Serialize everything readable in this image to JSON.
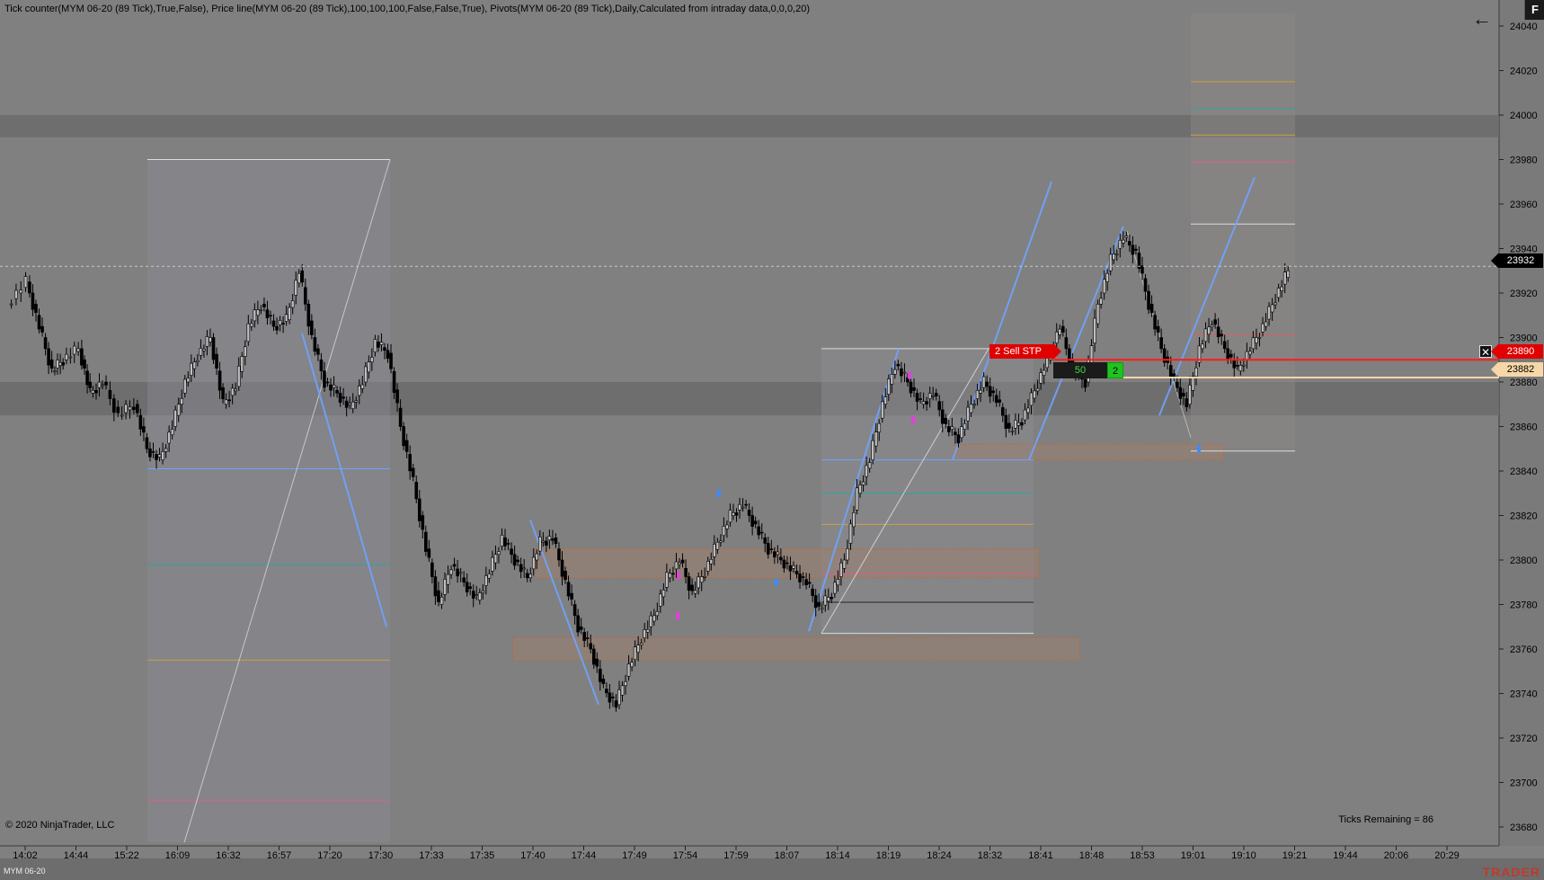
{
  "header": {
    "indicators": "Tick counter(MYM 06-20 (89 Tick),True,False), Price line(MYM 06-20 (89 Tick),100,100,100,False,False,True), Pivots(MYM 06-20 (89 Tick),Daily,Calculated from intraday data,0,0,0,20)"
  },
  "footer": {
    "copyright": "© 2020 NinjaTrader, LLC",
    "ticks_remaining": "Ticks Remaining = 86",
    "instrument": "MYM 06-20",
    "brand": "TRADER"
  },
  "toolbar": {
    "corner_label": "F",
    "back_icon": "arrow-left-icon"
  },
  "order": {
    "sell_label": "2  Sell STP",
    "position_pnl": "50",
    "position_qty": "2",
    "close_icon": "close-x-icon"
  },
  "price_tags": {
    "last": "23932",
    "sell_stop": "23890",
    "avg_entry": "23882"
  },
  "colors": {
    "background": "#808080",
    "candle": "#000000",
    "swing_line": "#6fa3ff",
    "sell_line": "#ff1a1a",
    "entry_line": "#f5d7a8",
    "zone_border": "#c06a33"
  },
  "chart_data": {
    "type": "candlestick",
    "y_ticks": [
      24040,
      24020,
      24000,
      23980,
      23960,
      23940,
      23920,
      23900,
      23880,
      23860,
      23840,
      23820,
      23800,
      23780,
      23760,
      23740,
      23720,
      23700,
      23680
    ],
    "ylim": [
      23673,
      24046
    ],
    "x_ticks": [
      "14:02",
      "14:44",
      "15:22",
      "16:09",
      "16:32",
      "16:57",
      "17:20",
      "17:30",
      "17:33",
      "17:35",
      "17:40",
      "17:44",
      "17:49",
      "17:54",
      "17:59",
      "18:07",
      "18:14",
      "18:19",
      "18:24",
      "18:32",
      "18:41",
      "18:48",
      "18:53",
      "19:01",
      "19:10",
      "19:21",
      "19:44",
      "20:06",
      "20:29"
    ],
    "last_price": 23932,
    "sell_stop_price": 23890,
    "avg_entry_price": 23882,
    "pivot_bands": [
      [
        23990,
        24000
      ],
      [
        23865,
        23880
      ]
    ],
    "close_path": [
      [
        0,
        23915
      ],
      [
        12,
        23925
      ],
      [
        20,
        23905
      ],
      [
        28,
        23885
      ],
      [
        35,
        23890
      ],
      [
        45,
        23895
      ],
      [
        52,
        23875
      ],
      [
        60,
        23880
      ],
      [
        70,
        23865
      ],
      [
        80,
        23870
      ],
      [
        88,
        23850
      ],
      [
        96,
        23845
      ],
      [
        104,
        23860
      ],
      [
        112,
        23880
      ],
      [
        120,
        23892
      ],
      [
        128,
        23900
      ],
      [
        136,
        23870
      ],
      [
        144,
        23878
      ],
      [
        152,
        23905
      ],
      [
        160,
        23915
      ],
      [
        168,
        23905
      ],
      [
        176,
        23908
      ],
      [
        184,
        23930
      ],
      [
        192,
        23900
      ],
      [
        200,
        23880
      ],
      [
        208,
        23875
      ],
      [
        216,
        23868
      ],
      [
        224,
        23880
      ],
      [
        232,
        23898
      ],
      [
        240,
        23893
      ],
      [
        248,
        23860
      ],
      [
        256,
        23835
      ],
      [
        264,
        23805
      ],
      [
        272,
        23780
      ],
      [
        280,
        23798
      ],
      [
        288,
        23790
      ],
      [
        296,
        23782
      ],
      [
        304,
        23795
      ],
      [
        312,
        23810
      ],
      [
        320,
        23800
      ],
      [
        328,
        23792
      ],
      [
        336,
        23808
      ],
      [
        344,
        23810
      ],
      [
        352,
        23790
      ],
      [
        360,
        23770
      ],
      [
        368,
        23760
      ],
      [
        376,
        23742
      ],
      [
        384,
        23735
      ],
      [
        392,
        23752
      ],
      [
        400,
        23765
      ],
      [
        408,
        23775
      ],
      [
        416,
        23792
      ],
      [
        424,
        23800
      ],
      [
        432,
        23785
      ],
      [
        440,
        23795
      ],
      [
        448,
        23808
      ],
      [
        456,
        23820
      ],
      [
        464,
        23825
      ],
      [
        472,
        23815
      ],
      [
        480,
        23805
      ],
      [
        488,
        23800
      ],
      [
        496,
        23795
      ],
      [
        504,
        23790
      ],
      [
        512,
        23778
      ],
      [
        520,
        23785
      ],
      [
        528,
        23800
      ],
      [
        536,
        23830
      ],
      [
        544,
        23845
      ],
      [
        552,
        23870
      ],
      [
        560,
        23888
      ],
      [
        568,
        23880
      ],
      [
        576,
        23870
      ],
      [
        584,
        23875
      ],
      [
        592,
        23860
      ],
      [
        600,
        23855
      ],
      [
        608,
        23870
      ],
      [
        616,
        23880
      ],
      [
        624,
        23872
      ],
      [
        632,
        23858
      ],
      [
        640,
        23863
      ],
      [
        648,
        23876
      ],
      [
        656,
        23890
      ],
      [
        664,
        23905
      ],
      [
        672,
        23885
      ],
      [
        680,
        23880
      ],
      [
        688,
        23915
      ],
      [
        696,
        23935
      ],
      [
        704,
        23945
      ],
      [
        712,
        23938
      ],
      [
        720,
        23915
      ],
      [
        728,
        23895
      ],
      [
        736,
        23880
      ],
      [
        744,
        23870
      ],
      [
        752,
        23895
      ],
      [
        760,
        23908
      ],
      [
        768,
        23895
      ],
      [
        776,
        23885
      ],
      [
        784,
        23895
      ],
      [
        792,
        23905
      ],
      [
        800,
        23918
      ],
      [
        808,
        23930
      ]
    ]
  }
}
